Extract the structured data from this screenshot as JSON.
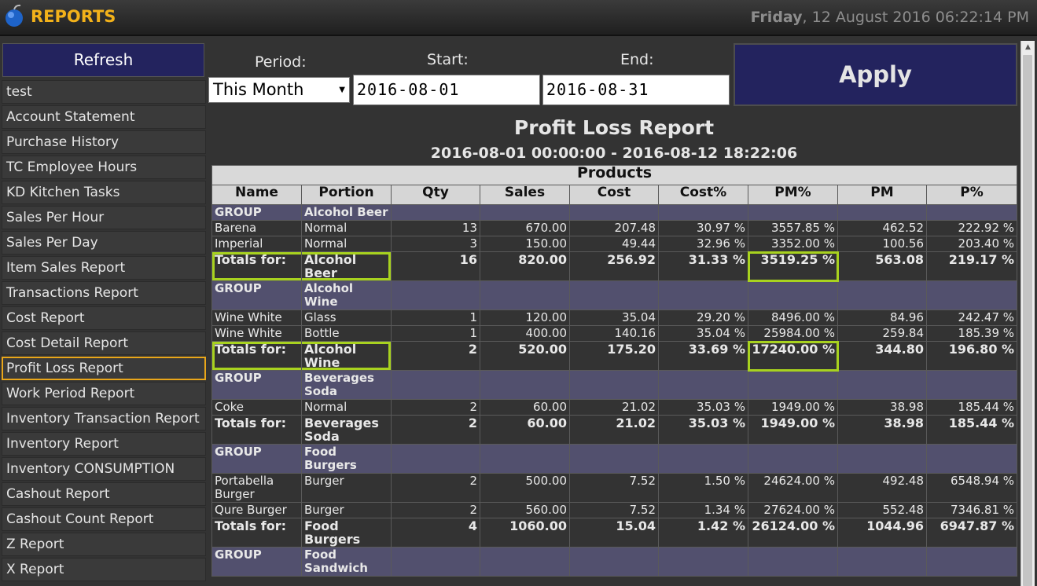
{
  "header": {
    "title": "REPORTS",
    "day": "Friday",
    "datetime": ", 12 August 2016 06:22:14 PM"
  },
  "sidebar": {
    "refresh_label": "Refresh",
    "items": [
      "test",
      "Account Statement",
      "Purchase History",
      "TC Employee Hours",
      "KD Kitchen Tasks",
      "Sales Per Hour",
      "Sales Per Day",
      "Item Sales Report",
      "Transactions Report",
      "Cost Report",
      "Cost Detail Report",
      "Profit Loss Report",
      "Work Period Report",
      "Inventory Transaction Report",
      "Inventory Report",
      "Inventory CONSUMPTION",
      "Cashout Report",
      "Cashout Count Report",
      "Z Report",
      "X Report"
    ],
    "active_item": "Profit Loss Report"
  },
  "filters": {
    "period_label": "Period:",
    "period_value": "This Month",
    "start_label": "Start:",
    "start_value": "2016-08-01",
    "end_label": "End:",
    "end_value": "2016-08-31",
    "apply_label": "Apply"
  },
  "report": {
    "title": "Profit Loss Report",
    "range": "2016-08-01 00:00:00 - 2016-08-12 18:22:06",
    "section": "Products",
    "columns": [
      "Name",
      "Portion",
      "Qty",
      "Sales",
      "Cost",
      "Cost%",
      "PM%",
      "PM",
      "P%"
    ],
    "group_label": "GROUP",
    "totals_label": "Totals for:",
    "groups": [
      {
        "name": "Alcohol Beer",
        "rows": [
          [
            "Barena",
            "Normal",
            "13",
            "670.00",
            "207.48",
            "30.97 %",
            "3557.85 %",
            "462.52",
            "222.92 %"
          ],
          [
            "Imperial",
            "Normal",
            "3",
            "150.00",
            "49.44",
            "32.96 %",
            "3352.00 %",
            "100.56",
            "203.40 %"
          ]
        ],
        "totals": [
          "Alcohol Beer",
          "16",
          "820.00",
          "256.92",
          "31.33 %",
          "3519.25 %",
          "563.08",
          "219.17 %"
        ]
      },
      {
        "name": "Alcohol Wine",
        "rows": [
          [
            "Wine White",
            "Glass",
            "1",
            "120.00",
            "35.04",
            "29.20 %",
            "8496.00 %",
            "84.96",
            "242.47 %"
          ],
          [
            "Wine White",
            "Bottle",
            "1",
            "400.00",
            "140.16",
            "35.04 %",
            "25984.00 %",
            "259.84",
            "185.39 %"
          ]
        ],
        "totals": [
          "Alcohol Wine",
          "2",
          "520.00",
          "175.20",
          "33.69 %",
          "17240.00 %",
          "344.80",
          "196.80 %"
        ]
      },
      {
        "name": "Beverages Soda",
        "rows": [
          [
            "Coke",
            "Normal",
            "2",
            "60.00",
            "21.02",
            "35.03 %",
            "1949.00 %",
            "38.98",
            "185.44 %"
          ]
        ],
        "totals": [
          "Beverages Soda",
          "2",
          "60.00",
          "21.02",
          "35.03 %",
          "1949.00 %",
          "38.98",
          "185.44 %"
        ]
      },
      {
        "name": "Food Burgers",
        "rows": [
          [
            "Portabella Burger",
            "Burger",
            "2",
            "500.00",
            "7.52",
            "1.50 %",
            "24624.00 %",
            "492.48",
            "6548.94 %"
          ],
          [
            "Qure Burger",
            "Burger",
            "2",
            "560.00",
            "7.52",
            "1.34 %",
            "27624.00 %",
            "552.48",
            "7346.81 %"
          ]
        ],
        "totals": [
          "Food Burgers",
          "4",
          "1060.00",
          "15.04",
          "1.42 %",
          "26124.00 %",
          "1044.96",
          "6947.87 %"
        ]
      },
      {
        "name": "Food Sandwich",
        "rows": [],
        "totals": null
      }
    ]
  },
  "colors": {
    "accent": "#f3b21a",
    "button_bg": "#23235e",
    "group_row": "#52506e",
    "highlight": "#a8d21f",
    "active_border": "#e9a61a"
  }
}
